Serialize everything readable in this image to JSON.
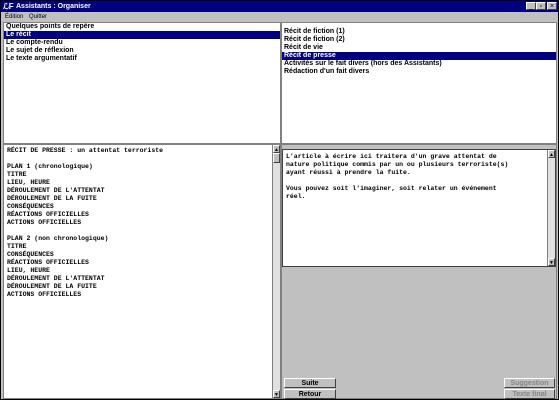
{
  "window": {
    "app_icon": "ℒF",
    "title": "Assistants : Organiser",
    "controls": {
      "minimize": "_",
      "maximize": "▫",
      "close": "×"
    }
  },
  "menu": {
    "items": [
      "Édition",
      "Quitter"
    ]
  },
  "topics": {
    "items": [
      "Quelques points de repère",
      "Le récit",
      "Le compte-rendu",
      "Le sujet de réflexion",
      "Le texte argumentatif"
    ],
    "selected_index": 1
  },
  "subtopics": {
    "items": [
      "Récit de fiction (1)",
      "Récit de fiction (2)",
      "Récit de vie",
      "Récit de presse",
      "Activités sur le fait divers (hors des Assistants)",
      "Rédaction d'un fait divers"
    ],
    "selected_index": 3
  },
  "plan_text": "RÉCIT DE PRESSE : un attentat terroriste\n\nPLAN 1 (chronologique)\nTITRE\nLIEU, HEURE\nDÉROULEMENT DE L'ATTENTAT\nDÉROULEMENT DE LA FUITE\nCONSÉQUENCES\nRÉACTIONS OFFICIELLES\nACTIONS OFFICIELLES\n\nPLAN 2 (non chronologique)\nTITRE\nCONSÉQUENCES\nRÉACTIONS OFFICIELLES\nLIEU, HEURE\nDÉROULEMENT DE L'ATTENTAT\nDÉROULEMENT DE LA FUITE\nACTIONS OFFICIELLES",
  "instructions_text": "L'article à écrire ici traitera d'un grave attentat de\nnature politique commis par un ou plusieurs terroriste(s)\nayant réussi à prendre la fuite.\n\nVous pouvez soit l'imaginer, soit relater un événement\nréel.",
  "buttons": {
    "next": "Suite",
    "back": "Retour",
    "suggestion": "Suggestion",
    "final_text": "Texte final"
  },
  "scroll_arrows": {
    "up": "▲",
    "down": "▼"
  }
}
